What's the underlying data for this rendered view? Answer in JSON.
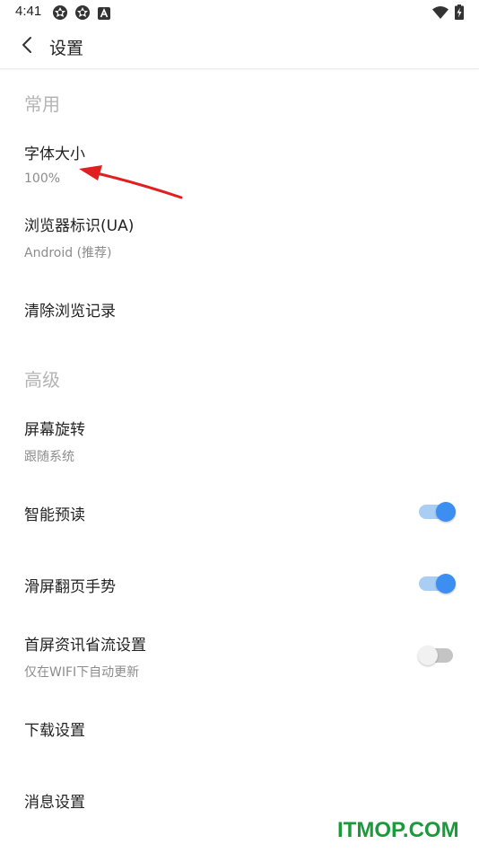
{
  "status_bar": {
    "time": "4:41",
    "icons": [
      "settings-gear-icon",
      "settings-gear-icon",
      "a-notification-icon",
      "wifi-icon",
      "battery-charging-icon"
    ]
  },
  "toolbar": {
    "back_icon": "chevron-left-icon",
    "title": "设置"
  },
  "sections": {
    "common": {
      "header": "常用",
      "font_size": {
        "title": "字体大小",
        "summary": "100%"
      },
      "user_agent": {
        "title": "浏览器标识(UA)",
        "summary": "Android (推荐)"
      },
      "clear_history": {
        "title": "清除浏览记录"
      }
    },
    "advanced": {
      "header": "高级",
      "screen_rotation": {
        "title": "屏幕旋转",
        "summary": "跟随系统"
      },
      "smart_preload": {
        "title": "智能预读",
        "enabled": true
      },
      "swipe_gesture": {
        "title": "滑屏翻页手势",
        "enabled": true
      },
      "data_saver": {
        "title": "首屏资讯省流设置",
        "summary": "仅在WIFI下自动更新",
        "enabled": false
      },
      "download_settings": {
        "title": "下载设置"
      },
      "message_settings": {
        "title": "消息设置"
      }
    }
  },
  "colors": {
    "switch_on": "#3c8ef0",
    "switch_on_track": "#a9cdf4",
    "switch_off_track": "#c4c4c4",
    "annotation_arrow": "#e02020",
    "watermark": "#1a9a3a"
  },
  "watermark": "ITMOP.COM"
}
